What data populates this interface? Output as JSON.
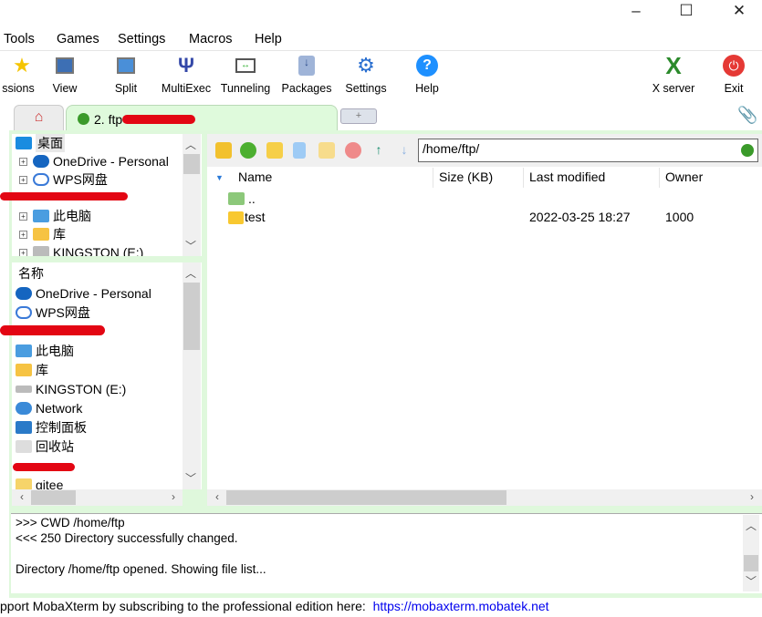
{
  "window_controls": {
    "minimize": "–",
    "maximize": "☐",
    "close": "✕"
  },
  "menu": [
    "Tools",
    "Games",
    "Settings",
    "Macros",
    "Help"
  ],
  "toolbar": [
    {
      "label": "ssions",
      "icon": "star-icon"
    },
    {
      "label": "View",
      "icon": "view-icon"
    },
    {
      "label": "Split",
      "icon": "split-icon"
    },
    {
      "label": "MultiExec",
      "icon": "multiexec-icon"
    },
    {
      "label": "Tunneling",
      "icon": "tunneling-icon"
    },
    {
      "label": "Packages",
      "icon": "packages-icon"
    },
    {
      "label": "Settings",
      "icon": "gear-icon"
    },
    {
      "label": "Help",
      "icon": "help-icon"
    },
    {
      "label": "X server",
      "icon": "x-server-icon"
    },
    {
      "label": "Exit",
      "icon": "power-icon"
    }
  ],
  "tabs": {
    "active_label": "2. ftp",
    "plus": "+"
  },
  "tree": {
    "items": [
      "桌面",
      "OneDrive - Personal",
      "WPS网盘",
      "此电脑",
      "库",
      "KINGSTON (E:)"
    ]
  },
  "local_list": {
    "header": "名称",
    "items": [
      "OneDrive - Personal",
      "WPS网盘",
      "此电脑",
      "库",
      "KINGSTON (E:)",
      "Network",
      "控制面板",
      "回收站",
      "gitee"
    ]
  },
  "remote": {
    "path": "/home/ftp/",
    "columns": [
      "Name",
      "Size (KB)",
      "Last modified",
      "Owner"
    ],
    "rows": [
      {
        "name": "..",
        "size": "",
        "modified": "",
        "owner": ""
      },
      {
        "name": "test",
        "size": "",
        "modified": "2022-03-25 18:27",
        "owner": "1000"
      }
    ]
  },
  "log": [
    ">>>  CWD /home/ftp",
    "<<<  250 Directory successfully changed.",
    "Directory /home/ftp opened. Showing file list..."
  ],
  "status": {
    "text": "pport MobaXterm by subscribing to the professional edition here:",
    "link": "https://mobaxterm.mobatek.net"
  },
  "colors": {
    "tab_green": "#dffadc",
    "link": "#0000ee",
    "redaction": "#e30613"
  }
}
